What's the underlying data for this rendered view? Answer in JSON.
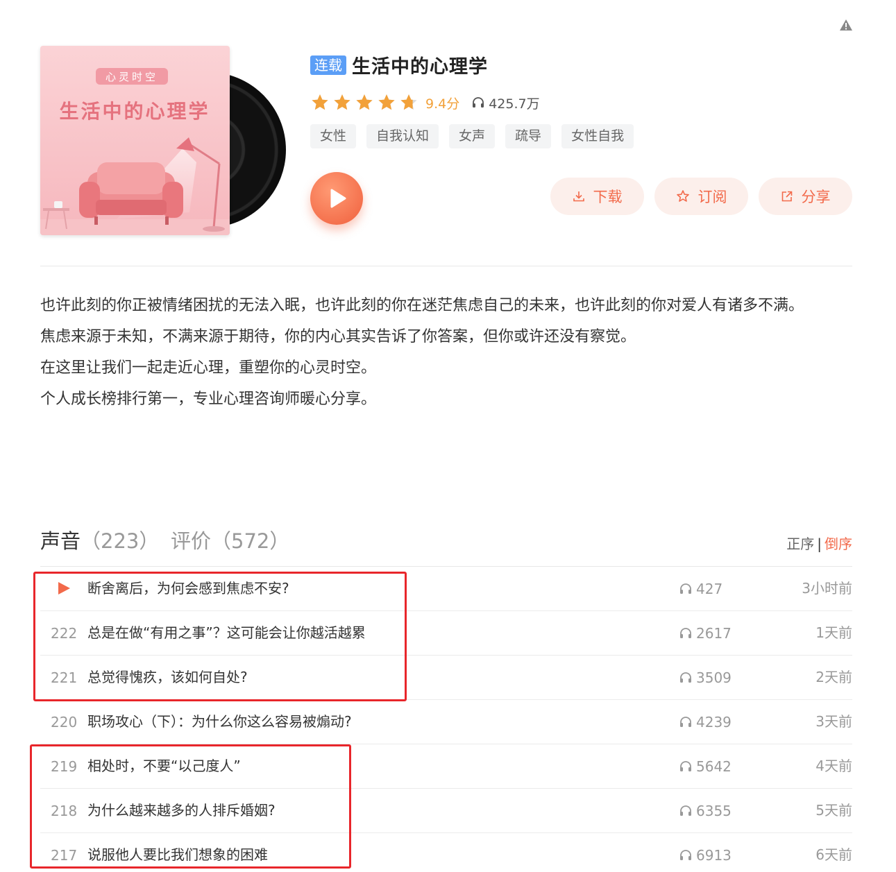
{
  "album": {
    "serial_tag": "连载",
    "title": "生活中的心理学",
    "cover_brand": "心灵时空",
    "cover_title": "生活中的心理学",
    "score": "9.4分",
    "rating": 4.7,
    "plays": "425.7万",
    "tags": [
      "女性",
      "自我认知",
      "女声",
      "疏导",
      "女性自我"
    ],
    "accent_color": "#f26a4b",
    "star_color": "#f2a13a"
  },
  "actions": {
    "download": "下载",
    "subscribe": "订阅",
    "share": "分享"
  },
  "description": [
    "也许此刻的你正被情绪困扰的无法入眠，也许此刻的你在迷茫焦虑自己的未来，也许此刻的你对爱人有诸多不满。",
    "焦虑来源于未知，不满来源于期待，你的内心其实告诉了你答案，但你或许还没有察觉。",
    "在这里让我们一起走近心理，重塑你的心灵时空。",
    "个人成长榜排行第一，专业心理咨询师暖心分享。"
  ],
  "list": {
    "tab_sounds": "声音",
    "tab_sounds_count": "（223）",
    "tab_reviews": "评价（572）",
    "sort_asc": "正序",
    "sort_sep": "|",
    "sort_desc": "倒序",
    "tracks": [
      {
        "index": "",
        "title": "断舍离后，为何会感到焦虑不安?",
        "plays": "427",
        "time": "3小时前",
        "playing": true
      },
      {
        "index": "222",
        "title": "总是在做“有用之事”？这可能会让你越活越累",
        "plays": "2617",
        "time": "1天前"
      },
      {
        "index": "221",
        "title": "总觉得愧疚，该如何自处?",
        "plays": "3509",
        "time": "2天前"
      },
      {
        "index": "220",
        "title": "职场攻心（下）：为什么你这么容易被煽动?",
        "plays": "4239",
        "time": "3天前"
      },
      {
        "index": "219",
        "title": "相处时，不要“以己度人”",
        "plays": "5642",
        "time": "4天前"
      },
      {
        "index": "218",
        "title": "为什么越来越多的人排斥婚姻?",
        "plays": "6355",
        "time": "5天前"
      },
      {
        "index": "217",
        "title": "说服他人要比我们想象的困难",
        "plays": "6913",
        "time": "6天前"
      }
    ]
  }
}
